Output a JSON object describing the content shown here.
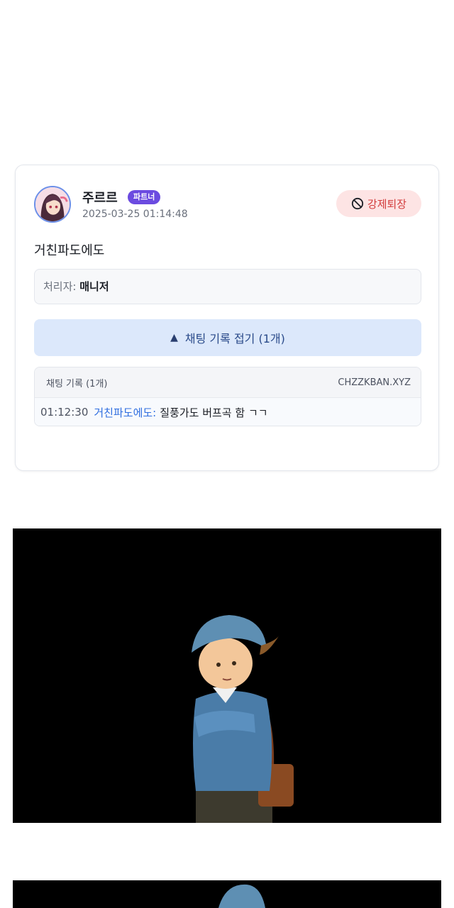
{
  "post": {
    "author": "주르르",
    "badge": "파트너",
    "timestamp": "2025-03-25 01:14:48",
    "action_button": "강제퇴장",
    "message": "거친파도에도",
    "handler_label": "처리자:",
    "handler_name": "매니저",
    "toggle_label": "채팅 기록 접기 (1개)",
    "log_title": "채팅 기록 (1개)",
    "log_source": "CHZZKBAN.XYZ",
    "log_entries": [
      {
        "time": "01:12:30",
        "user": "거친파도에도:",
        "text": "질풍가도 버프곡 함 ㄱㄱ"
      }
    ]
  },
  "colors": {
    "badge": "#6b4be0",
    "kick_bg": "#fde4e4",
    "kick_text": "#d23b3b",
    "toggle_bg": "#dce8fb",
    "log_user": "#2f6ee0"
  },
  "icons": [
    "prohibit-icon",
    "triangle-up-icon"
  ]
}
